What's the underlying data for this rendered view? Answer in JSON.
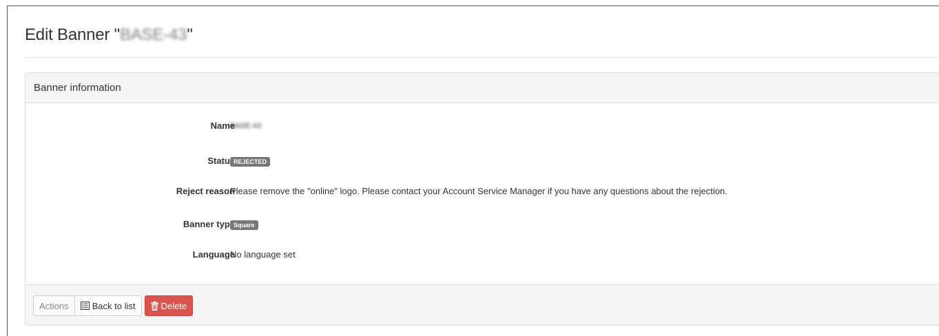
{
  "page": {
    "title_prefix": "Edit Banner \"",
    "title_name": "BASE-43",
    "title_suffix": "\""
  },
  "panel": {
    "heading": "Banner information",
    "fields": {
      "name": {
        "label": "Name",
        "value": "BASE-43"
      },
      "status": {
        "label": "Status",
        "value": "REJECTED"
      },
      "reject_reason": {
        "label": "Reject reason",
        "value": "Please remove the \"online\" logo. Please contact your Account Service Manager if you have any questions about the rejection."
      },
      "banner_type": {
        "label": "Banner type",
        "value": "Square"
      },
      "language": {
        "label": "Language",
        "value": "No language set"
      }
    }
  },
  "footer": {
    "actions_label": "Actions",
    "back_label": "Back to list",
    "back_icon": "list-icon",
    "delete_label": "Delete",
    "delete_icon": "trash-icon"
  },
  "colors": {
    "badge": "#777777",
    "danger": "#d9534f",
    "panel_bg": "#f5f5f5"
  }
}
